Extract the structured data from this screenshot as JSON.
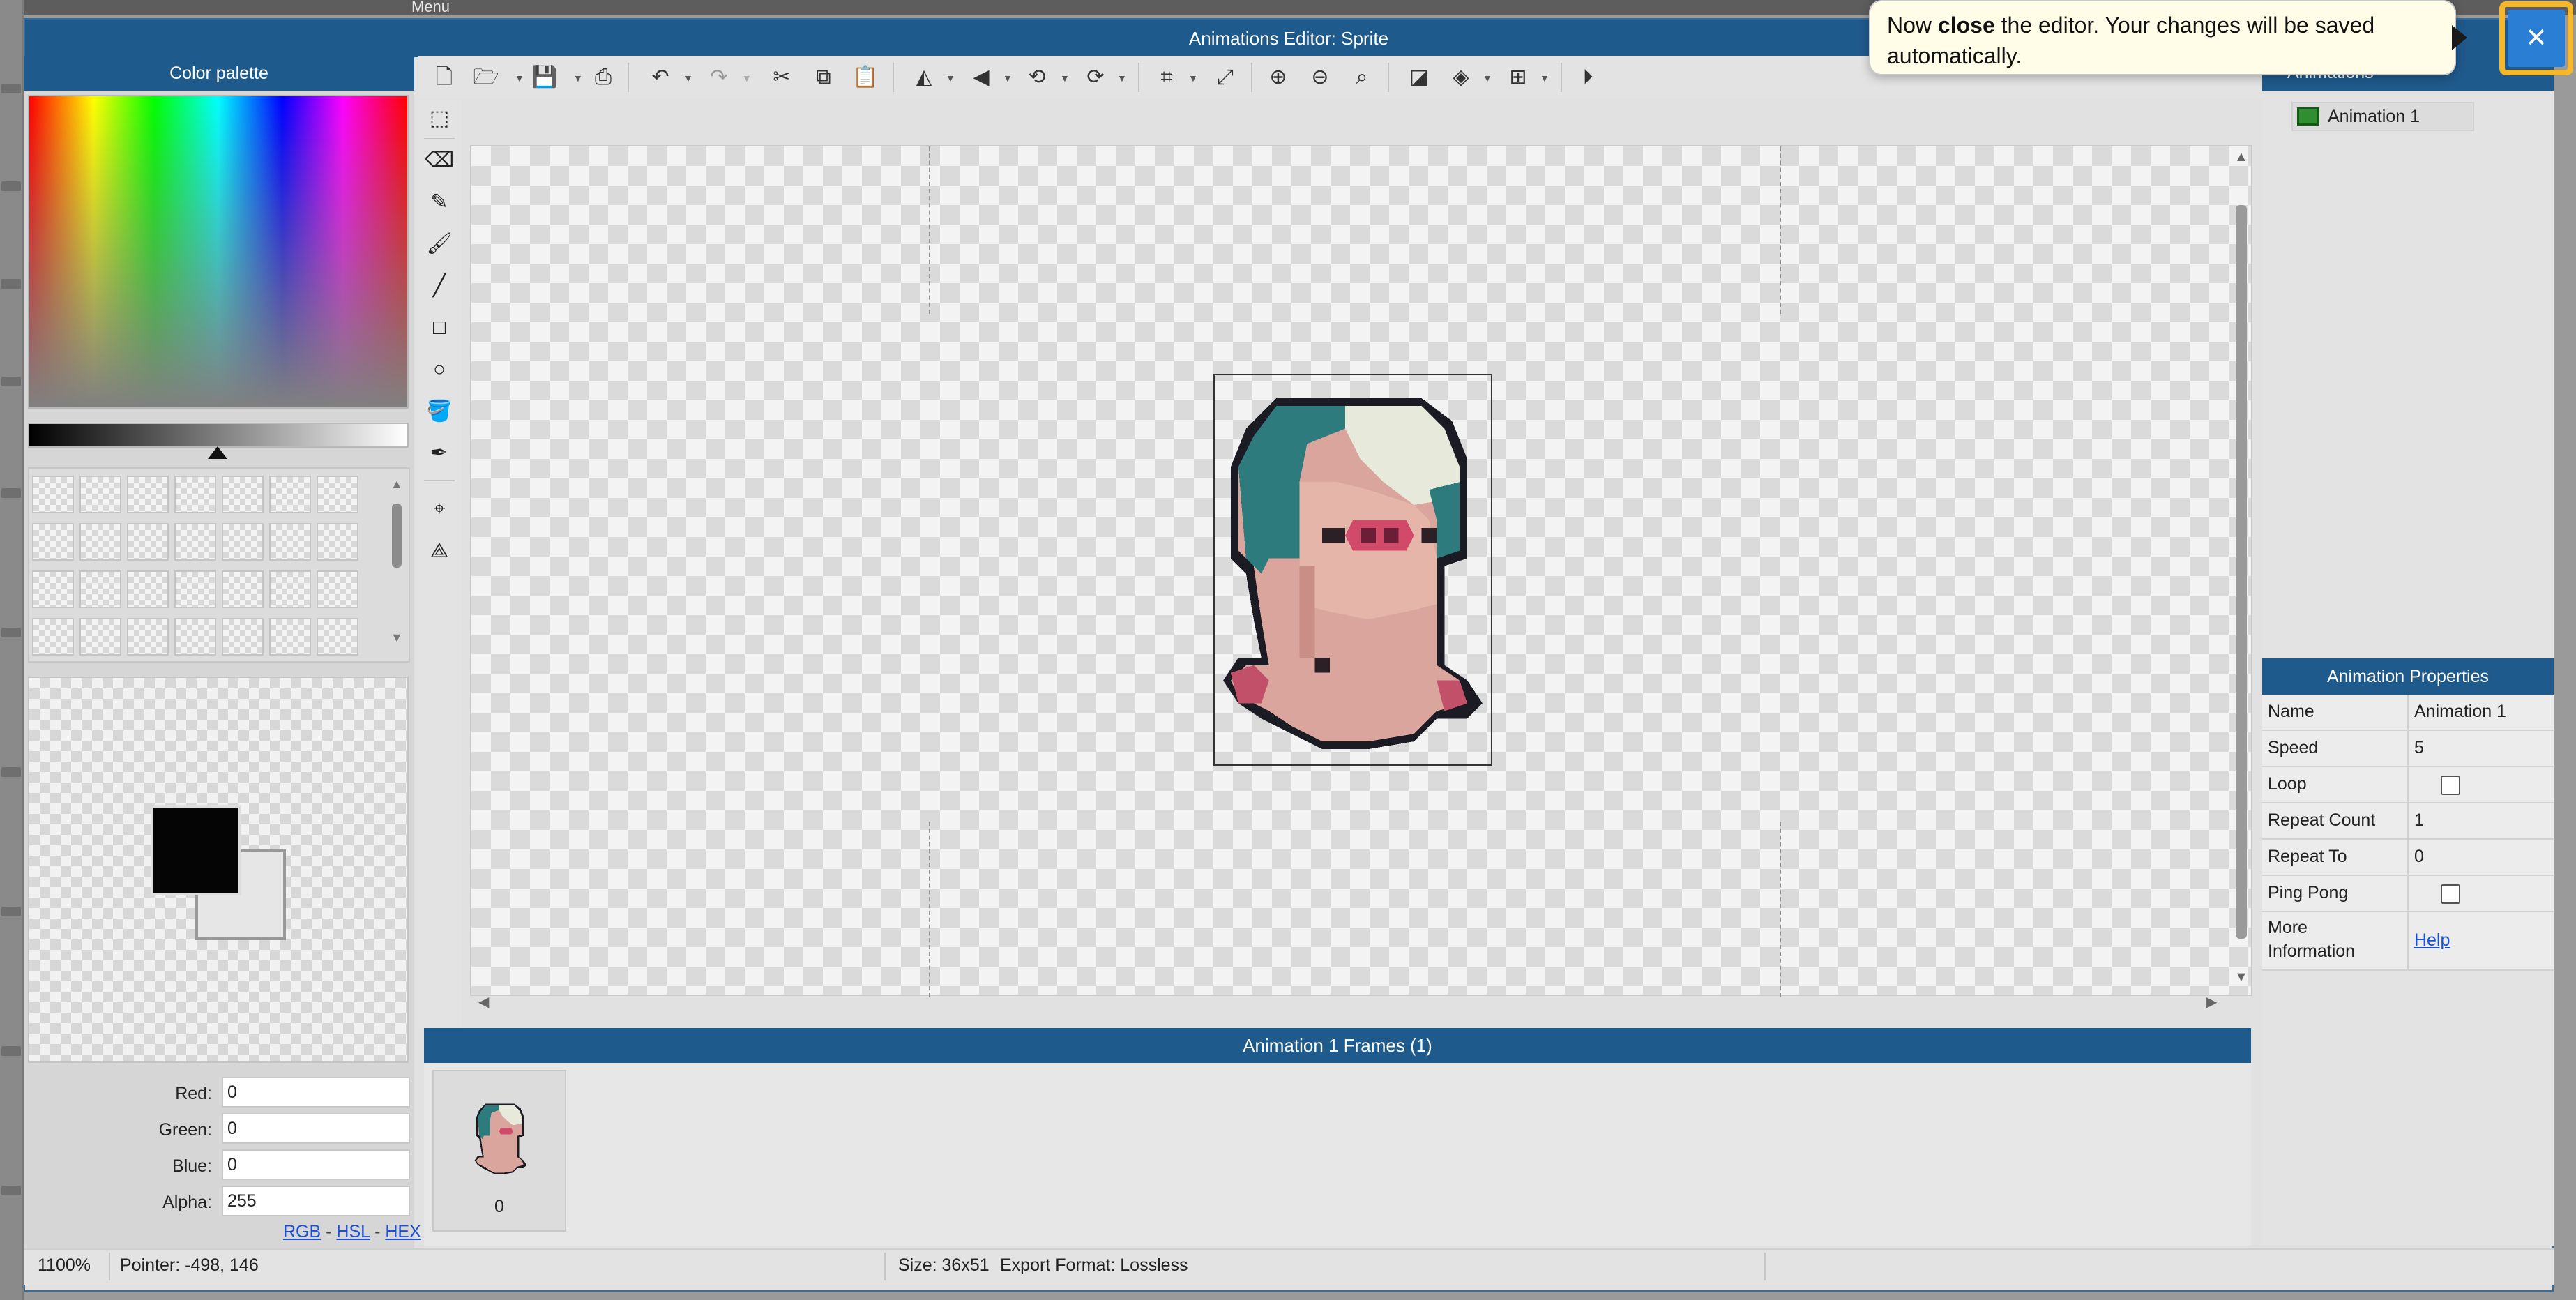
{
  "background": {
    "menu_label": "Menu"
  },
  "editor": {
    "title": "Animations Editor: Sprite"
  },
  "color_palette": {
    "title": "Color palette",
    "red_label": "Red:",
    "red_value": "0",
    "green_label": "Green:",
    "green_value": "0",
    "blue_label": "Blue:",
    "blue_value": "0",
    "alpha_label": "Alpha:",
    "alpha_value": "255",
    "mode_rgb": "RGB",
    "mode_hsl": "HSL",
    "mode_hex": "HEX",
    "mode_sep": " - ",
    "primary_color": "#050505",
    "secondary_color": "#e6e6e6"
  },
  "toolbar": {
    "icons": [
      "new-file",
      "open",
      "save",
      "export",
      "undo",
      "redo",
      "cut",
      "copy",
      "paste",
      "flip-horizontal",
      "flip-vertical",
      "rotate-counterclockwise",
      "rotate-clockwise",
      "crop",
      "resize",
      "zoom-in",
      "zoom-out",
      "zoom-reset",
      "transparency",
      "layers",
      "grid",
      "play"
    ]
  },
  "tools": [
    "rectangle-select",
    "eraser",
    "pencil",
    "brush",
    "line",
    "rectangle",
    "ellipse",
    "paint-bucket",
    "color-picker",
    "point",
    "polygon-points"
  ],
  "frames": {
    "title": "Animation 1 Frames (1)",
    "items": [
      {
        "index": "0"
      }
    ]
  },
  "animations_list": {
    "header": "Animations",
    "items": [
      {
        "label": "Animation 1"
      }
    ]
  },
  "properties": {
    "title": "Animation Properties",
    "name_label": "Name",
    "name_value": "Animation 1",
    "speed_label": "Speed",
    "speed_value": "5",
    "loop_label": "Loop",
    "loop_checked": false,
    "repeat_count_label": "Repeat Count",
    "repeat_count_value": "1",
    "repeat_to_label": "Repeat To",
    "repeat_to_value": "0",
    "ping_pong_label": "Ping Pong",
    "ping_pong_checked": false,
    "more_info_label_1": "More",
    "more_info_label_2": "Information",
    "more_info_link": "Help"
  },
  "status": {
    "zoom": "1100%",
    "pointer": "Pointer: -498, 146",
    "size": "Size: 36x51",
    "export_format": "Export Format: Lossless"
  },
  "tooltip": {
    "before": "Now ",
    "bold": "close",
    "after": " the editor. Your changes will be saved automatically."
  },
  "close_button": {
    "label": "✕"
  },
  "colors": {
    "accent": "#1f5a8c",
    "highlight": "#f5b82a",
    "close": "#2a7fd4"
  }
}
